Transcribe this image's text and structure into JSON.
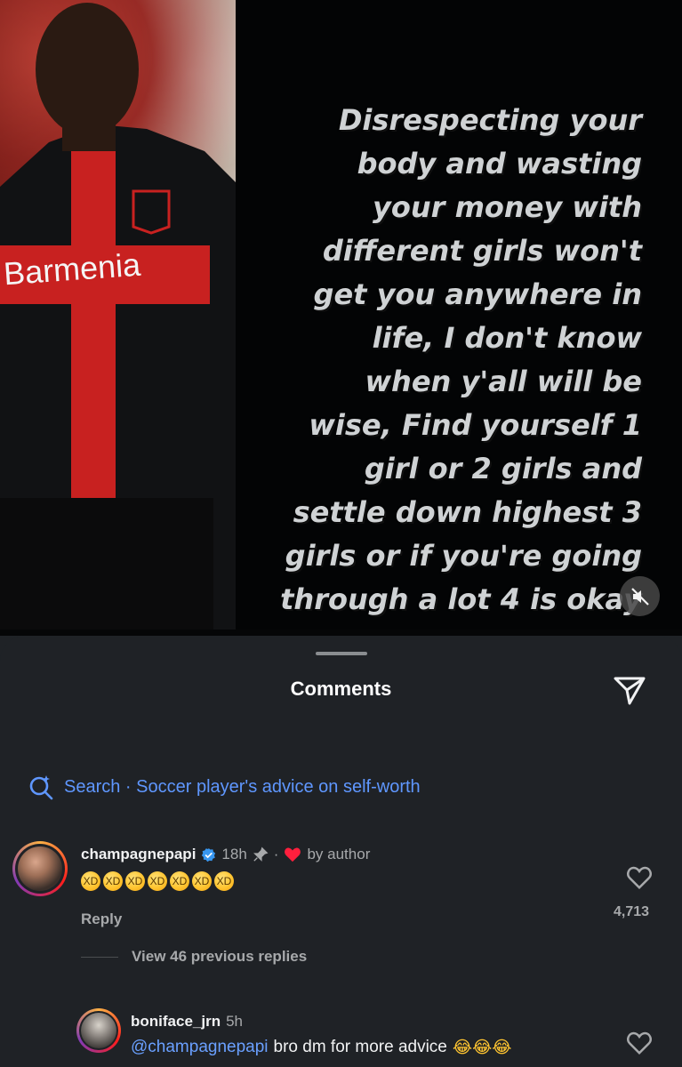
{
  "story": {
    "lines": [
      "Disrespecting your",
      "body and wasting",
      "your money with",
      "different girls won't",
      "get you anywhere in",
      "life, I don't know",
      "when y'all will be",
      "wise, Find yourself 1",
      "girl or 2 girls and",
      "settle down highest 3",
      "girls or if you're going",
      "through a lot 4 is okay"
    ],
    "photo_sponsor_text": "Barmenia",
    "mute_icon": "speaker-muted-icon"
  },
  "sheet": {
    "title": "Comments",
    "share_icon": "paper-plane-icon"
  },
  "search": {
    "label": "Search · Soccer player's advice on self-worth",
    "icon": "sparkle-search-icon",
    "color": "#5f97ff"
  },
  "comments": [
    {
      "username": "champagnepapi",
      "verified": true,
      "time": "18h",
      "pinned": true,
      "liked_by": "by author",
      "text": "🤣🤣🤣🤣🤣🤣🤣",
      "reply_label": "Reply",
      "likes": "4,713",
      "view_replies": "View 46 previous replies"
    },
    {
      "username": "boniface_jrn",
      "time": "5h",
      "mention": "@champagnepapi",
      "text": "bro dm for more advice",
      "emojis": "😂😂😂"
    }
  ]
}
